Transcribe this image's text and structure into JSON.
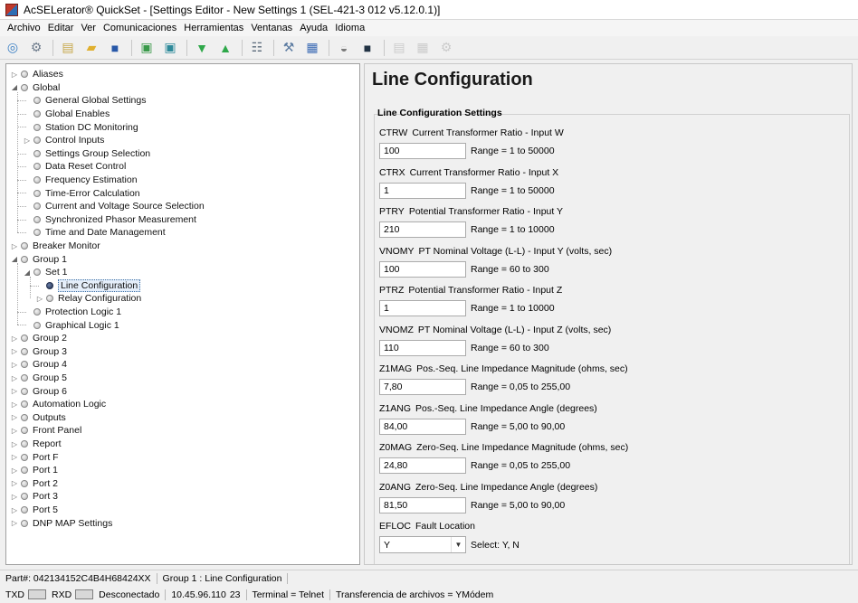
{
  "window": {
    "title": "AcSELerator® QuickSet - [Settings Editor - New Settings 1 (SEL-421-3 012 v5.12.0.1)]"
  },
  "menu": [
    "Archivo",
    "Editar",
    "Ver",
    "Comunicaciones",
    "Herramientas",
    "Ventanas",
    "Ayuda",
    "Idioma"
  ],
  "toolbar": {
    "buttons": [
      {
        "icon": "connect-icon",
        "glyph": "◎",
        "color": "#3a7fc4"
      },
      {
        "icon": "settings-wrench-icon",
        "glyph": "⚙",
        "color": "#6e7c8c"
      },
      {
        "icon": "new-file-icon",
        "glyph": "▤",
        "color": "#c7a84a"
      },
      {
        "icon": "open-folder-icon",
        "glyph": "▰",
        "color": "#e0b030"
      },
      {
        "icon": "save-icon",
        "glyph": "■",
        "color": "#2858a8"
      },
      {
        "icon": "read-icon",
        "glyph": "▣",
        "color": "#3a9a4a"
      },
      {
        "icon": "send-icon",
        "glyph": "▣",
        "color": "#2e8a9a"
      },
      {
        "icon": "green-down-icon",
        "glyph": "▼",
        "color": "#2fa84a"
      },
      {
        "icon": "green-up-icon",
        "glyph": "▲",
        "color": "#2fa84a"
      },
      {
        "icon": "network-icon",
        "glyph": "☷",
        "color": "#5a6a7a"
      },
      {
        "icon": "tools-icon",
        "glyph": "⚒",
        "color": "#5a7aa0"
      },
      {
        "icon": "report-icon",
        "glyph": "▦",
        "color": "#3a6ab4"
      },
      {
        "icon": "gauge-icon",
        "glyph": "◒",
        "color": "#7a7a7a"
      },
      {
        "icon": "terminal-icon",
        "glyph": "■",
        "color": "#223344"
      },
      {
        "icon": "doc-disabled-icon",
        "glyph": "▤",
        "color": "#888888"
      },
      {
        "icon": "table-disabled-icon",
        "glyph": "▦",
        "color": "#888888"
      },
      {
        "icon": "gear-disabled-icon",
        "glyph": "⚙",
        "color": "#888888"
      }
    ]
  },
  "tree": {
    "items": [
      {
        "label": "Aliases",
        "level": 0,
        "expander": "closed"
      },
      {
        "label": "Global",
        "level": 0,
        "expander": "open"
      },
      {
        "label": "General Global Settings",
        "level": 1,
        "expander": "none"
      },
      {
        "label": "Global Enables",
        "level": 1,
        "expander": "none"
      },
      {
        "label": "Station DC Monitoring",
        "level": 1,
        "expander": "none"
      },
      {
        "label": "Control Inputs",
        "level": 1,
        "expander": "closed"
      },
      {
        "label": "Settings Group Selection",
        "level": 1,
        "expander": "none"
      },
      {
        "label": "Data Reset Control",
        "level": 1,
        "expander": "none"
      },
      {
        "label": "Frequency Estimation",
        "level": 1,
        "expander": "none"
      },
      {
        "label": "Time-Error Calculation",
        "level": 1,
        "expander": "none"
      },
      {
        "label": "Current and Voltage Source Selection",
        "level": 1,
        "expander": "none"
      },
      {
        "label": "Synchronized Phasor Measurement",
        "level": 1,
        "expander": "none"
      },
      {
        "label": "Time and Date Management",
        "level": 1,
        "expander": "none"
      },
      {
        "label": "Breaker Monitor",
        "level": 0,
        "expander": "closed"
      },
      {
        "label": "Group 1",
        "level": 0,
        "expander": "open"
      },
      {
        "label": "Set 1",
        "level": 1,
        "expander": "open"
      },
      {
        "label": "Line Configuration",
        "level": 2,
        "expander": "none",
        "selected": true
      },
      {
        "label": "Relay Configuration",
        "level": 2,
        "expander": "closed"
      },
      {
        "label": "Protection Logic 1",
        "level": 1,
        "expander": "none"
      },
      {
        "label": "Graphical Logic 1",
        "level": 1,
        "expander": "none"
      },
      {
        "label": "Group 2",
        "level": 0,
        "expander": "closed"
      },
      {
        "label": "Group 3",
        "level": 0,
        "expander": "closed"
      },
      {
        "label": "Group 4",
        "level": 0,
        "expander": "closed"
      },
      {
        "label": "Group 5",
        "level": 0,
        "expander": "closed"
      },
      {
        "label": "Group 6",
        "level": 0,
        "expander": "closed"
      },
      {
        "label": "Automation Logic",
        "level": 0,
        "expander": "closed"
      },
      {
        "label": "Outputs",
        "level": 0,
        "expander": "closed"
      },
      {
        "label": "Front Panel",
        "level": 0,
        "expander": "closed"
      },
      {
        "label": "Report",
        "level": 0,
        "expander": "closed"
      },
      {
        "label": "Port F",
        "level": 0,
        "expander": "closed"
      },
      {
        "label": "Port 1",
        "level": 0,
        "expander": "closed"
      },
      {
        "label": "Port 2",
        "level": 0,
        "expander": "closed"
      },
      {
        "label": "Port 3",
        "level": 0,
        "expander": "closed"
      },
      {
        "label": "Port 5",
        "level": 0,
        "expander": "closed"
      },
      {
        "label": "DNP MAP Settings",
        "level": 0,
        "expander": "closed"
      }
    ]
  },
  "editor": {
    "title": "Line Configuration",
    "section": "Line Configuration Settings",
    "settings": [
      {
        "code": "CTRW",
        "label": "Current Transformer Ratio - Input W",
        "value": "100",
        "range": "Range = 1 to 50000"
      },
      {
        "code": "CTRX",
        "label": "Current Transformer Ratio - Input X",
        "value": "1",
        "range": "Range = 1 to 50000"
      },
      {
        "code": "PTRY",
        "label": "Potential Transformer Ratio - Input Y",
        "value": "210",
        "range": "Range = 1 to 10000"
      },
      {
        "code": "VNOMY",
        "label": "PT Nominal Voltage (L-L) - Input Y (volts, sec)",
        "value": "100",
        "range": "Range = 60 to 300"
      },
      {
        "code": "PTRZ",
        "label": "Potential Transformer Ratio - Input Z",
        "value": "1",
        "range": "Range = 1 to 10000"
      },
      {
        "code": "VNOMZ",
        "label": "PT Nominal Voltage (L-L) - Input Z (volts, sec)",
        "value": "110",
        "range": "Range = 60 to 300"
      },
      {
        "code": "Z1MAG",
        "label": "Pos.-Seq. Line Impedance Magnitude (ohms, sec)",
        "value": "7,80",
        "range": "Range = 0,05 to 255,00"
      },
      {
        "code": "Z1ANG",
        "label": "Pos.-Seq. Line Impedance Angle (degrees)",
        "value": "84,00",
        "range": "Range = 5,00 to 90,00"
      },
      {
        "code": "Z0MAG",
        "label": "Zero-Seq. Line Impedance Magnitude (ohms, sec)",
        "value": "24,80",
        "range": "Range = 0,05 to 255,00"
      },
      {
        "code": "Z0ANG",
        "label": "Zero-Seq. Line Impedance Angle (degrees)",
        "value": "81,50",
        "range": "Range = 5,00 to 90,00"
      },
      {
        "code": "EFLOC",
        "label": "Fault Location",
        "value": "Y",
        "range": "Select: Y, N",
        "type": "select"
      }
    ]
  },
  "status": {
    "part": "Part#: 042134152C4B4H68424XX",
    "location": "Group 1 : Line Configuration",
    "txd": "TXD",
    "rxd": "RXD",
    "connection": "Desconectado",
    "address": "10.45.96.110",
    "port": "23",
    "terminal": "Terminal = Telnet",
    "transfer": "Transferencia de archivos = YMódem"
  }
}
